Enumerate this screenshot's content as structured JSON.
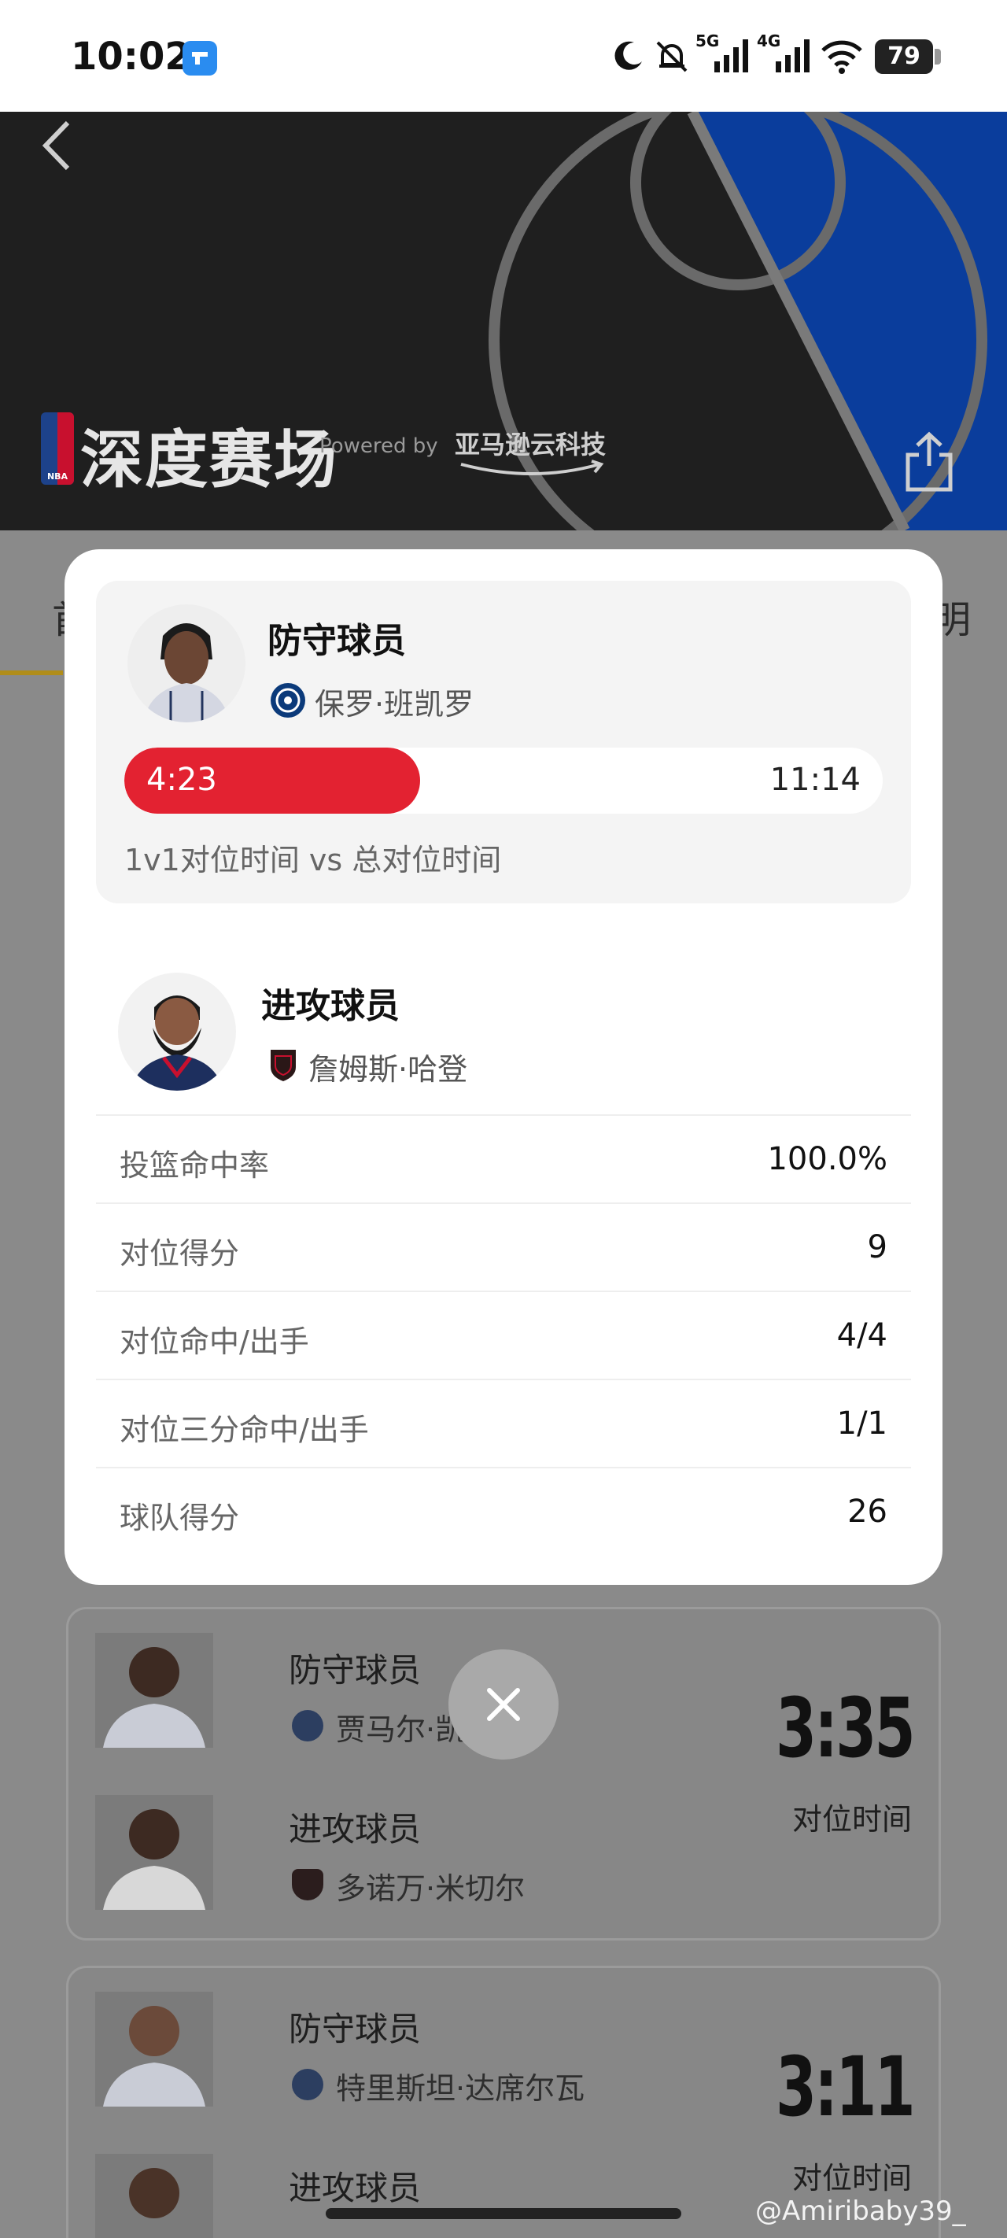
{
  "status_bar": {
    "time": "10:02",
    "net_5g": "5G",
    "net_4g": "4G",
    "battery": "79"
  },
  "hero": {
    "nba_logo_text": "NBA",
    "title": "深度赛场",
    "powered_by": "Powered by",
    "partner": "亚马逊云科技"
  },
  "tabs": {
    "left_partial": "首",
    "right_partial": "明"
  },
  "modal": {
    "defender": {
      "role": "防守球员",
      "name": "保罗·班凯罗",
      "team_icon": "magic-logo-icon",
      "matchup_time": "4:23",
      "total_time": "11:14",
      "matchup_fraction": 0.39,
      "caption": "1v1对位时间 vs 总对位时间"
    },
    "attacker": {
      "role": "进攻球员",
      "name": "詹姆斯·哈登",
      "team_icon": "clippers-logo-icon"
    },
    "stats": [
      {
        "label": "投篮命中率",
        "value": "100.0%"
      },
      {
        "label": "对位得分",
        "value": "9"
      },
      {
        "label": "对位命中/出手",
        "value": "4/4"
      },
      {
        "label": "对位三分命中/出手",
        "value": "1/1"
      },
      {
        "label": "球队得分",
        "value": "26"
      }
    ]
  },
  "background_cards": [
    {
      "defender_role": "防守球员",
      "defender_name": "贾马尔·凯恩",
      "attacker_role": "进攻球员",
      "attacker_name": "多诺万·米切尔",
      "time": "3:35",
      "time_label": "对位时间"
    },
    {
      "defender_role": "防守球员",
      "defender_name": "特里斯坦·达席尔瓦",
      "attacker_role": "进攻球员",
      "time": "3:11",
      "time_label": "对位时间"
    }
  ],
  "watermark": "@Amiribaby39_",
  "colors": {
    "accent_red": "#e32231",
    "hero_dark": "#1f1f1f",
    "court_blue": "#0a3d9c"
  }
}
